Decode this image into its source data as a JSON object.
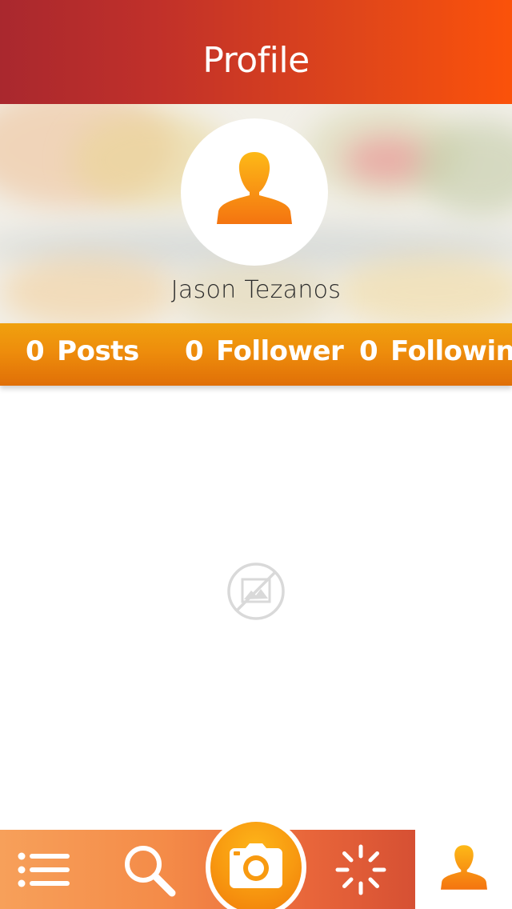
{
  "header": {
    "title": "Profile"
  },
  "profile": {
    "name": "Jason Tezanos",
    "avatar_icon": "user-silhouette-icon"
  },
  "stats": {
    "posts_count": "0",
    "posts_label": "Posts",
    "followers_count": "0",
    "followers_label": "Follower",
    "following_count": "0",
    "following_label": "Following"
  },
  "content": {
    "empty_icon": "no-image-icon"
  },
  "tabbar": {
    "items": [
      {
        "name": "feed",
        "icon": "list-icon"
      },
      {
        "name": "search",
        "icon": "search-icon"
      },
      {
        "name": "camera",
        "icon": "camera-icon"
      },
      {
        "name": "explore",
        "icon": "loading-spinner-icon"
      },
      {
        "name": "profile",
        "icon": "user-icon",
        "selected": true
      }
    ]
  },
  "colors": {
    "header_start": "#a9282e",
    "header_end": "#fb520a",
    "stats_bar": "#ee8d0c",
    "accent_orange": "#f7941d",
    "tabbar_start": "#f7a05a",
    "tabbar_end": "#d65033"
  }
}
